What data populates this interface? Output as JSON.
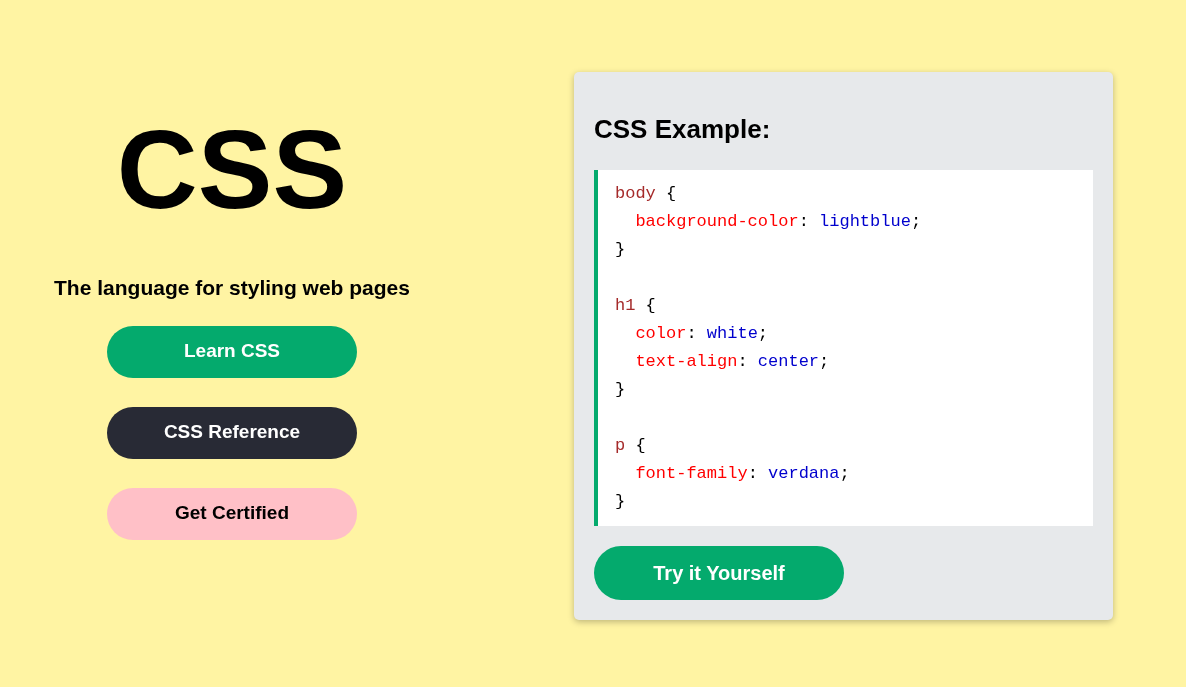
{
  "hero": {
    "title": "CSS",
    "subtitle": "The language for styling web pages",
    "buttons": [
      {
        "label": "Learn CSS",
        "kind": "primary"
      },
      {
        "label": "CSS Reference",
        "kind": "dark"
      },
      {
        "label": "Get Certified",
        "kind": "pink"
      }
    ]
  },
  "example": {
    "heading": "CSS Example:",
    "code_lines": [
      {
        "tokens": [
          {
            "kind": "selector",
            "text": "body"
          },
          {
            "kind": "punct",
            "text": " {"
          }
        ]
      },
      {
        "tokens": [
          {
            "kind": "property",
            "text": "  background-color"
          },
          {
            "kind": "punct",
            "text": ": "
          },
          {
            "kind": "value",
            "text": "lightblue"
          },
          {
            "kind": "punct",
            "text": ";"
          }
        ]
      },
      {
        "tokens": [
          {
            "kind": "punct",
            "text": "}"
          }
        ]
      },
      {
        "kind": "blank"
      },
      {
        "tokens": [
          {
            "kind": "selector",
            "text": "h1"
          },
          {
            "kind": "punct",
            "text": " {"
          }
        ]
      },
      {
        "tokens": [
          {
            "kind": "property",
            "text": "  color"
          },
          {
            "kind": "punct",
            "text": ": "
          },
          {
            "kind": "value",
            "text": "white"
          },
          {
            "kind": "punct",
            "text": ";"
          }
        ]
      },
      {
        "tokens": [
          {
            "kind": "property",
            "text": "  text-align"
          },
          {
            "kind": "punct",
            "text": ": "
          },
          {
            "kind": "value",
            "text": "center"
          },
          {
            "kind": "punct",
            "text": ";"
          }
        ]
      },
      {
        "tokens": [
          {
            "kind": "punct",
            "text": "}"
          }
        ]
      },
      {
        "kind": "blank"
      },
      {
        "tokens": [
          {
            "kind": "selector",
            "text": "p"
          },
          {
            "kind": "punct",
            "text": " {"
          }
        ]
      },
      {
        "tokens": [
          {
            "kind": "property",
            "text": "  font-family"
          },
          {
            "kind": "punct",
            "text": ": "
          },
          {
            "kind": "value",
            "text": "verdana"
          },
          {
            "kind": "punct",
            "text": ";"
          }
        ]
      },
      {
        "tokens": [
          {
            "kind": "punct",
            "text": "}"
          }
        ]
      }
    ],
    "button": {
      "label": "Try it Yourself",
      "kind": "primary"
    }
  }
}
